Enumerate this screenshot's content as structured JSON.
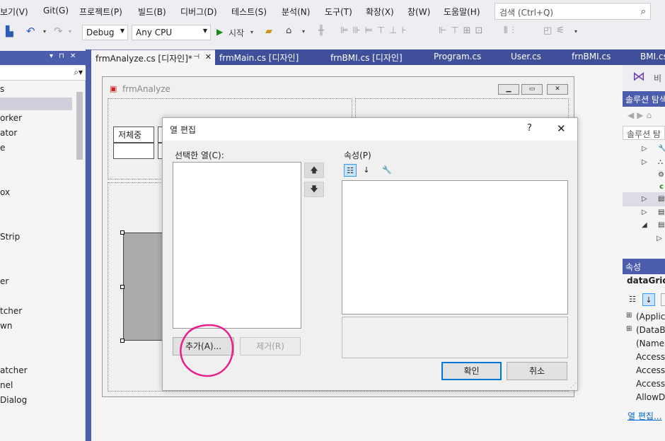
{
  "menubar": {
    "items": [
      "보기(V)",
      "Git(G)",
      "프로젝트(P)",
      "빌드(B)",
      "디버그(D)",
      "테스트(S)",
      "분석(N)",
      "도구(T)",
      "확장(X)",
      "창(W)",
      "도움말(H)"
    ],
    "search_placeholder": "검색 (Ctrl+Q)"
  },
  "toolbar": {
    "config": "Debug",
    "platform": "Any CPU",
    "start_label": "시작"
  },
  "doc_tabs": [
    {
      "label": "frmAnalyze.cs [디자인]*",
      "active": true,
      "pin": "⊣"
    },
    {
      "label": "frmMain.cs [디자인]",
      "active": false
    },
    {
      "label": "frnBMI.cs [디자인]",
      "active": false
    },
    {
      "label": "Program.cs",
      "active": false
    },
    {
      "label": "User.cs",
      "active": false
    },
    {
      "label": "frnBMI.cs",
      "active": false
    },
    {
      "label": "BMI.cs",
      "active": false
    }
  ],
  "left_panel": {
    "items": [
      "s",
      "orker",
      "ator",
      "e",
      "ox",
      "Strip",
      "er",
      "tcher",
      "wn",
      "atcher",
      "nel",
      "Dialog"
    ]
  },
  "form": {
    "title": "frmAnalyze",
    "cell_label": "저체중"
  },
  "dialog": {
    "title": "열 편집",
    "help": "?",
    "close": "✕",
    "selected_columns_label": "선택한 열(C):",
    "properties_label": "속성(P)",
    "add_button": "추가(A)...",
    "remove_button": "제거(R)",
    "ok_button": "확인",
    "cancel_button": "취소"
  },
  "solution_explorer": {
    "header": "솔루션 탐색기",
    "search": "솔루션 탐",
    "tab_label": "비"
  },
  "properties": {
    "header": "속성",
    "object": "dataGridV",
    "rows": [
      "(Applica",
      "(DataBi",
      "(Name)",
      "Accessi",
      "Accessi",
      "Accessi",
      "AllowD"
    ],
    "link": "열 편집..."
  },
  "colors": {
    "accent": "#4d5dad",
    "annotation": "#e81e8c"
  }
}
